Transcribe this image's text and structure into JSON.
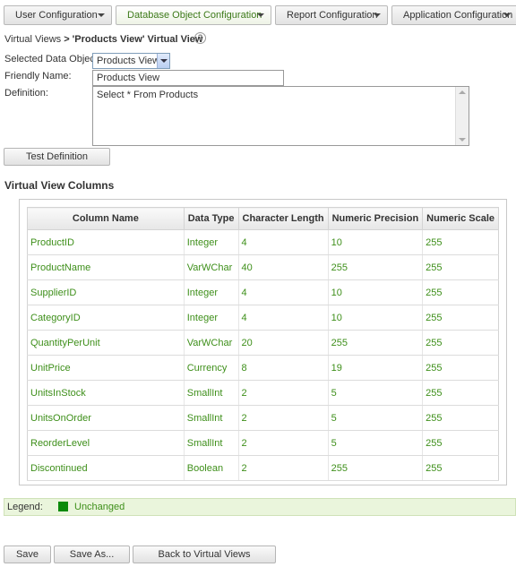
{
  "tabs": [
    {
      "label": "User Configuration",
      "active": false
    },
    {
      "label": "Database Object Configuration",
      "active": true
    },
    {
      "label": "Report Configuration",
      "active": false
    },
    {
      "label": "Application Configuration",
      "active": false
    }
  ],
  "breadcrumb": {
    "parent": "Virtual Views",
    "separator": ">",
    "current": "'Products View' Virtual View"
  },
  "help_icon": "?",
  "form": {
    "selected_object_label": "Selected Data Object:",
    "selected_object_value": "Products View",
    "friendly_name_label": "Friendly Name:",
    "friendly_name_value": "Products View",
    "definition_label": "Definition:",
    "definition_value": "Select * From Products",
    "test_button": "Test Definition"
  },
  "section_title": "Virtual View Columns",
  "table": {
    "headers": [
      "Column Name",
      "Data Type",
      "Character Length",
      "Numeric Precision",
      "Numeric Scale"
    ],
    "rows": [
      [
        "ProductID",
        "Integer",
        "4",
        "10",
        "255"
      ],
      [
        "ProductName",
        "VarWChar",
        "40",
        "255",
        "255"
      ],
      [
        "SupplierID",
        "Integer",
        "4",
        "10",
        "255"
      ],
      [
        "CategoryID",
        "Integer",
        "4",
        "10",
        "255"
      ],
      [
        "QuantityPerUnit",
        "VarWChar",
        "20",
        "255",
        "255"
      ],
      [
        "UnitPrice",
        "Currency",
        "8",
        "19",
        "255"
      ],
      [
        "UnitsInStock",
        "SmallInt",
        "2",
        "5",
        "255"
      ],
      [
        "UnitsOnOrder",
        "SmallInt",
        "2",
        "5",
        "255"
      ],
      [
        "ReorderLevel",
        "SmallInt",
        "2",
        "5",
        "255"
      ],
      [
        "Discontinued",
        "Boolean",
        "2",
        "255",
        "255"
      ]
    ]
  },
  "legend": {
    "label": "Legend:",
    "item": "Unchanged",
    "color": "#0a8a0a"
  },
  "buttons": {
    "save": "Save",
    "save_as": "Save As...",
    "back": "Back to Virtual Views"
  },
  "colors": {
    "accent_green": "#3e8f1a",
    "legend_bg": "#eaf5dc"
  }
}
